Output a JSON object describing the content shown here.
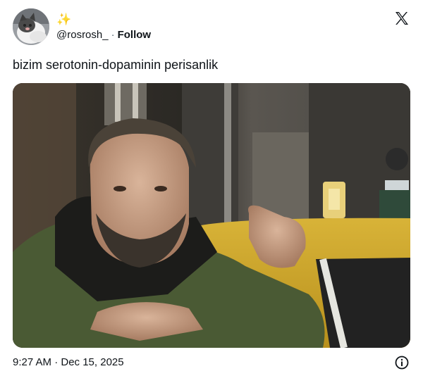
{
  "author": {
    "display_name": "✨",
    "handle": "@rosrosh_",
    "separator": "·",
    "follow_label": "Follow"
  },
  "tweet": {
    "text": "bizim serotonin-dopaminin perisanlik",
    "timestamp": "9:27 AM · Dec 15, 2025"
  },
  "colors": {
    "accent_star": "#e0b400",
    "text_primary": "#0f1419",
    "text_secondary": "#536471"
  },
  "icons": {
    "brand": "x-logo-icon",
    "info": "info-icon"
  }
}
